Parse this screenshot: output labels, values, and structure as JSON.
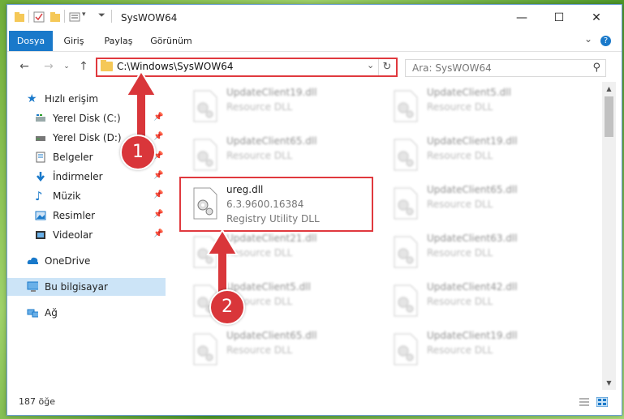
{
  "window": {
    "title": "SysWOW64",
    "caption": {
      "minimize": "—",
      "maximize": "☐",
      "close": "✕"
    }
  },
  "ribbon": {
    "tabs": [
      {
        "label": "Dosya",
        "active": true
      },
      {
        "label": "Giriş",
        "active": false
      },
      {
        "label": "Paylaş",
        "active": false
      },
      {
        "label": "Görünüm",
        "active": false
      }
    ],
    "collapse_glyph": "⌄",
    "help_glyph": "?"
  },
  "nav": {
    "back": "←",
    "forward": "→",
    "dropdown": "⌄",
    "up": "↑"
  },
  "address": {
    "path": "C:\\Windows\\SysWOW64",
    "dropdown": "⌄",
    "refresh": "↻"
  },
  "search": {
    "placeholder": "Ara: SysWOW64",
    "icon": "⚲"
  },
  "sidebar": {
    "items": [
      {
        "label": "Hızlı erişim",
        "icon": "star-icon",
        "pinned": false
      },
      {
        "label": "Yerel Disk (C:)",
        "icon": "drive-icon",
        "pinned": true
      },
      {
        "label": "Yerel Disk (D:)",
        "icon": "drive-icon",
        "pinned": true
      },
      {
        "label": "Belgeler",
        "icon": "documents-icon",
        "pinned": true
      },
      {
        "label": "İndirmeler",
        "icon": "downloads-icon",
        "pinned": true
      },
      {
        "label": "Müzik",
        "icon": "music-icon",
        "pinned": true
      },
      {
        "label": "Resimler",
        "icon": "pictures-icon",
        "pinned": true
      },
      {
        "label": "Videolar",
        "icon": "videos-icon",
        "pinned": true
      },
      {
        "label": "OneDrive",
        "icon": "cloud-icon",
        "pinned": false
      },
      {
        "label": "Bu bilgisayar",
        "icon": "computer-icon",
        "pinned": false,
        "selected": true
      },
      {
        "label": "Ağ",
        "icon": "network-icon",
        "pinned": false
      }
    ],
    "pin_glyph": "📌"
  },
  "files": [
    {
      "name": "UpdateClient19.dll",
      "desc": "Resource DLL",
      "blurred": true
    },
    {
      "name": "UpdateClient5.dll",
      "desc": "Resource DLL",
      "blurred": true
    },
    {
      "name": "UpdateClient65.dll",
      "desc": "Resource DLL",
      "blurred": true
    },
    {
      "name": "UpdateClient19.dll",
      "desc": "Resource DLL",
      "blurred": true
    },
    {
      "name": "ureg.dll",
      "version": "6.3.9600.16384",
      "desc": "Registry Utility DLL",
      "blurred": false
    },
    {
      "name": "UpdateClient65.dll",
      "desc": "Resource DLL",
      "blurred": true
    },
    {
      "name": "UpdateClient21.dll",
      "desc": "Resource DLL",
      "blurred": true
    },
    {
      "name": "UpdateClient63.dll",
      "desc": "Resource DLL",
      "blurred": true
    },
    {
      "name": "UpdateClient5.dll",
      "desc": "Resource DLL",
      "blurred": true
    },
    {
      "name": "UpdateClient42.dll",
      "desc": "Resource DLL",
      "blurred": true
    },
    {
      "name": "UpdateClient65.dll",
      "desc": "Resource DLL",
      "blurred": true
    },
    {
      "name": "UpdateClient19.dll",
      "desc": "Resource DLL",
      "blurred": true
    }
  ],
  "status": {
    "count": "187 öğe"
  },
  "annotations": {
    "badge1": "1",
    "badge2": "2",
    "color": "#e0393e"
  },
  "colors": {
    "accent": "#1979ca",
    "highlight": "#e0393e",
    "selection": "#cce4f7"
  }
}
